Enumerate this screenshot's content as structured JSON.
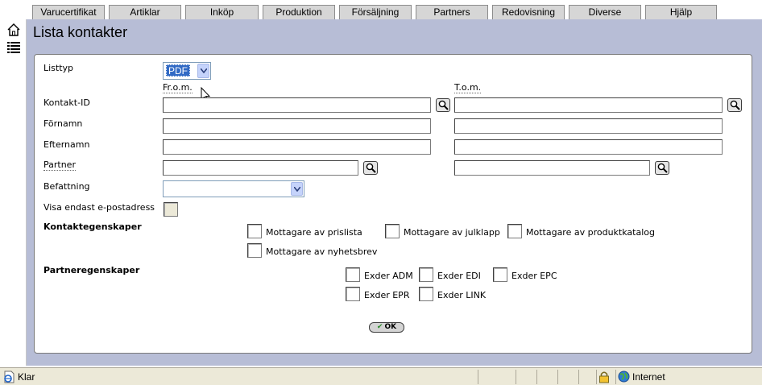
{
  "menu": {
    "tabs": [
      "Varucertifikat",
      "Artiklar",
      "Inköp",
      "Produktion",
      "Försäljning",
      "Partners",
      "Redovisning",
      "Diverse",
      "Hjälp"
    ]
  },
  "page": {
    "title": "Lista kontakter"
  },
  "form": {
    "listtyp_label": "Listtyp",
    "listtyp_value": "PDF",
    "from_label": "Fr.o.m.",
    "tom_label": "T.o.m.",
    "kontakt_id_label": "Kontakt-ID",
    "fornamn_label": "Förnamn",
    "efternamn_label": "Efternamn",
    "partner_label": "Partner",
    "befattning_label": "Befattning",
    "visa_epost_label": "Visa endast e-postadress",
    "kontaktegenskaper_label": "Kontaktegenskaper",
    "kontakt_options": [
      "Mottagare av prislista",
      "Mottagare av julklapp",
      "Mottagare av produktkatalog",
      "Mottagare av nyhetsbrev"
    ],
    "partneregenskaper_label": "Partneregenskaper",
    "partner_options": [
      "Exder ADM",
      "Exder EDI",
      "Exder EPC",
      "Exder EPR",
      "Exder LINK"
    ],
    "ok_label": "OK"
  },
  "statusbar": {
    "status_text": "Klar",
    "zone_text": "Internet"
  },
  "colors": {
    "main_bg": "#b7bdd6",
    "tab_bg": "#d6d6d6",
    "select_highlight": "#316ac5",
    "statusbar_bg": "#ece9d8"
  }
}
